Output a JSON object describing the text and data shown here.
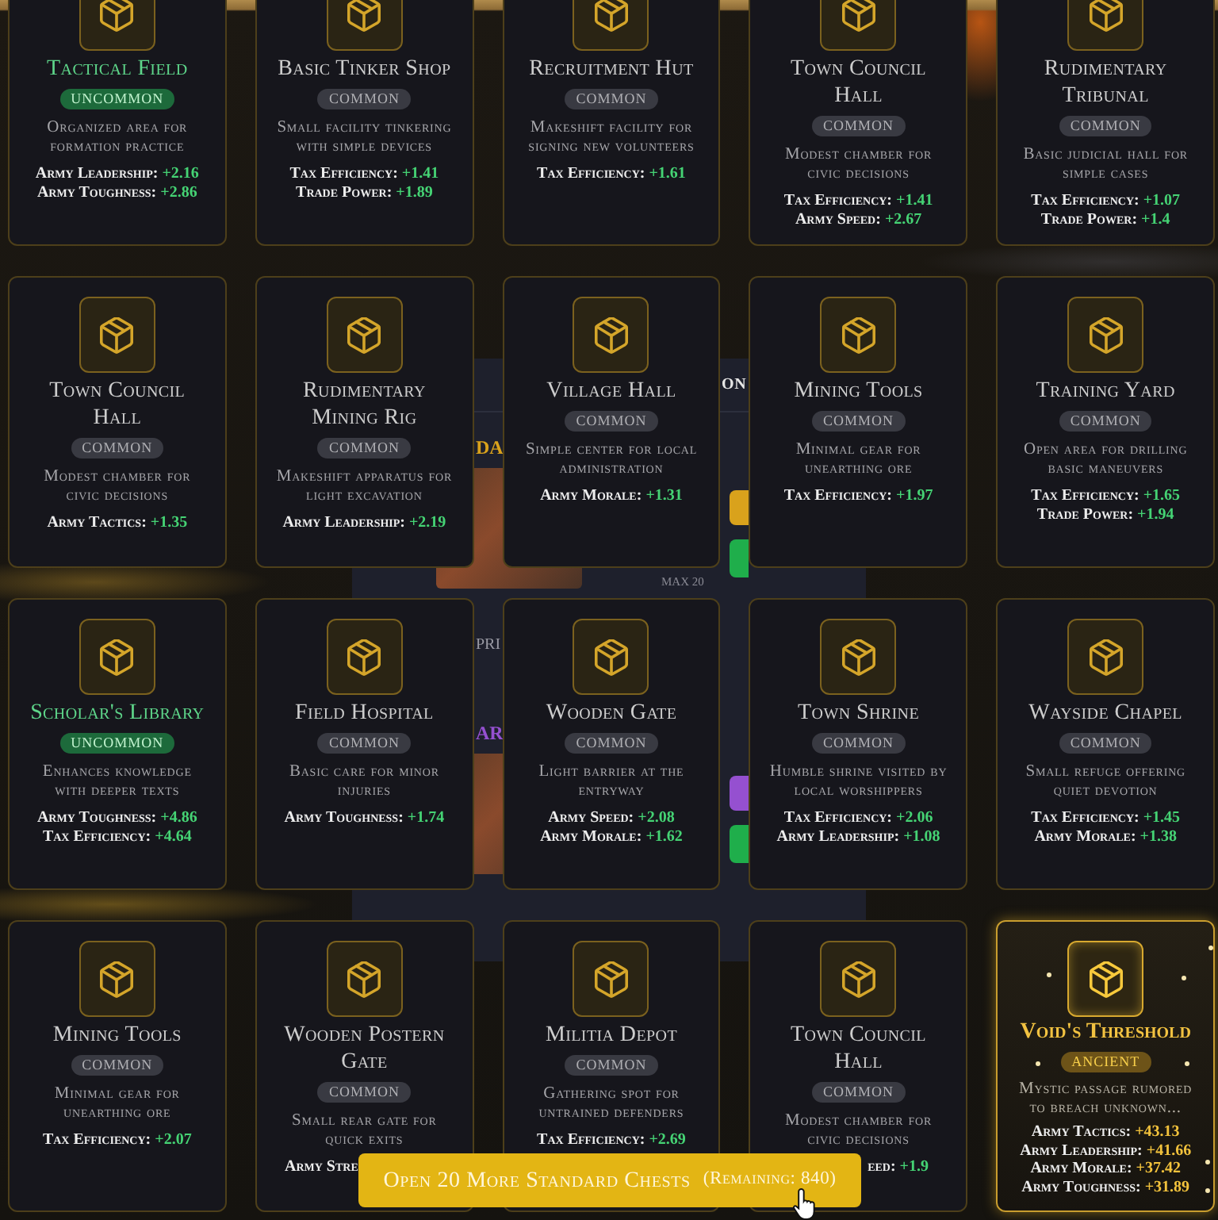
{
  "backdrop": {
    "dialog_title": "ON",
    "chests": [
      {
        "title": "DA",
        "color": "#d9a21c",
        "price": "PRI",
        "max": "MAX 20"
      },
      {
        "title": "AR",
        "color": "#9550d0"
      }
    ]
  },
  "cards": [
    {
      "kind": "uncommon",
      "title": "Tactical Field",
      "badge": "UNCOMMON",
      "description": "Organized area for formation practice",
      "stats": [
        {
          "label": "Army Leadership:",
          "value": "+2.16"
        },
        {
          "label": "Army Toughness:",
          "value": "+2.86"
        }
      ]
    },
    {
      "kind": "common",
      "title": "Basic Tinker Shop",
      "badge": "COMMON",
      "description": "Small facility tinkering with simple devices",
      "stats": [
        {
          "label": "Tax Efficiency:",
          "value": "+1.41"
        },
        {
          "label": "Trade Power:",
          "value": "+1.89"
        }
      ]
    },
    {
      "kind": "common",
      "title": "Recruitment Hut",
      "badge": "COMMON",
      "description": "Makeshift facility for signing new volunteers",
      "stats": [
        {
          "label": "Tax Efficiency:",
          "value": "+1.61"
        }
      ]
    },
    {
      "kind": "common",
      "title": "Town Council Hall",
      "badge": "COMMON",
      "description": "Modest chamber for civic decisions",
      "stats": [
        {
          "label": "Tax Efficiency:",
          "value": "+1.41"
        },
        {
          "label": "Army Speed:",
          "value": "+2.67"
        }
      ]
    },
    {
      "kind": "common",
      "title": "Rudimentary Tribunal",
      "badge": "COMMON",
      "description": "Basic judicial hall for simple cases",
      "stats": [
        {
          "label": "Tax Efficiency:",
          "value": "+1.07"
        },
        {
          "label": "Trade Power:",
          "value": "+1.4"
        }
      ]
    },
    {
      "kind": "common",
      "title": "Town Council Hall",
      "badge": "COMMON",
      "description": "Modest chamber for civic decisions",
      "stats": [
        {
          "label": "Army Tactics:",
          "value": "+1.35"
        }
      ]
    },
    {
      "kind": "common",
      "title": "Rudimentary Mining Rig",
      "badge": "COMMON",
      "description": "Makeshift apparatus for light excavation",
      "stats": [
        {
          "label": "Army Leadership:",
          "value": "+2.19"
        }
      ]
    },
    {
      "kind": "common",
      "title": "Village Hall",
      "badge": "COMMON",
      "description": "Simple center for local administration",
      "stats": [
        {
          "label": "Army Morale:",
          "value": "+1.31"
        }
      ]
    },
    {
      "kind": "common",
      "title": "Mining Tools",
      "badge": "COMMON",
      "description": "Minimal gear for unearthing ore",
      "stats": [
        {
          "label": "Tax Efficiency:",
          "value": "+1.97"
        }
      ]
    },
    {
      "kind": "common",
      "title": "Training Yard",
      "badge": "COMMON",
      "description": "Open area for drilling basic maneuvers",
      "stats": [
        {
          "label": "Tax Efficiency:",
          "value": "+1.65"
        },
        {
          "label": "Trade Power:",
          "value": "+1.94"
        }
      ]
    },
    {
      "kind": "uncommon",
      "title": "Scholar's Library",
      "badge": "UNCOMMON",
      "description": "Enhances knowledge with deeper texts",
      "stats": [
        {
          "label": "Army Toughness:",
          "value": "+4.86"
        },
        {
          "label": "Tax Efficiency:",
          "value": "+4.64"
        }
      ]
    },
    {
      "kind": "common",
      "title": "Field Hospital",
      "badge": "COMMON",
      "description": "Basic care for minor injuries",
      "stats": [
        {
          "label": "Army Toughness:",
          "value": "+1.74"
        }
      ]
    },
    {
      "kind": "common",
      "title": "Wooden Gate",
      "badge": "COMMON",
      "description": "Light barrier at the entryway",
      "stats": [
        {
          "label": "Army Speed:",
          "value": "+2.08"
        },
        {
          "label": "Army Morale:",
          "value": "+1.62"
        }
      ]
    },
    {
      "kind": "common",
      "title": "Town Shrine",
      "badge": "COMMON",
      "description": "Humble shrine visited by local worshippers",
      "stats": [
        {
          "label": "Tax Efficiency:",
          "value": "+2.06"
        },
        {
          "label": "Army Leadership:",
          "value": "+1.08"
        }
      ]
    },
    {
      "kind": "common",
      "title": "Wayside Chapel",
      "badge": "COMMON",
      "description": "Small refuge offering quiet devotion",
      "stats": [
        {
          "label": "Tax Efficiency:",
          "value": "+1.45"
        },
        {
          "label": "Army Morale:",
          "value": "+1.38"
        }
      ]
    },
    {
      "kind": "common",
      "title": "Mining Tools",
      "badge": "COMMON",
      "description": "Minimal gear for unearthing ore",
      "stats": [
        {
          "label": "Tax Efficiency:",
          "value": "+2.07"
        }
      ]
    },
    {
      "kind": "common",
      "title": "Wooden Postern Gate",
      "badge": "COMMON",
      "description": "Small rear gate for quick exits",
      "stats": [
        {
          "label": "Army Stre",
          "hidden_after": true
        }
      ]
    },
    {
      "kind": "common",
      "title": "Militia Depot",
      "badge": "COMMON",
      "description": "Gathering spot for untrained defenders",
      "stats": [
        {
          "label": "Tax Efficiency:",
          "value": "+2.69"
        }
      ]
    },
    {
      "kind": "common",
      "title": "Town Council Hall",
      "badge": "COMMON",
      "description": "Modest chamber for civic decisions",
      "stats": [
        {
          "label": "eed:",
          "value": "+1.9",
          "hidden_before": true
        }
      ]
    },
    {
      "kind": "ancient",
      "title": "Void's Threshold",
      "badge": "ANCIENT",
      "description": "Mystic passage rumored to breach unknown...",
      "stats": [
        {
          "label": "Army Tactics:",
          "value": "+43.13"
        },
        {
          "label": "Army Leadership:",
          "value": "+41.66"
        },
        {
          "label": "Army Morale:",
          "value": "+37.42"
        },
        {
          "label": "Army Toughness:",
          "value": "+31.89"
        }
      ]
    }
  ],
  "open_button": {
    "label": "Open 20 More Standard Chests",
    "remaining": "(Remaining: 840)"
  }
}
